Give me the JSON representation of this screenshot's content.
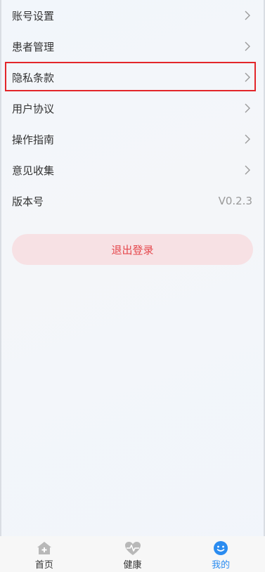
{
  "menu": {
    "items": [
      {
        "label": "账号设置"
      },
      {
        "label": "患者管理"
      },
      {
        "label": "隐私条款"
      },
      {
        "label": "用户协议"
      },
      {
        "label": "操作指南"
      },
      {
        "label": "意见收集"
      }
    ],
    "version_label": "版本号",
    "version_value": "V0.2.3",
    "highlighted_item": "隐私条款"
  },
  "logout": {
    "label": "退出登录"
  },
  "tabbar": {
    "tabs": [
      {
        "label": "首页",
        "icon": "home-icon"
      },
      {
        "label": "健康",
        "icon": "heart-pulse-icon"
      },
      {
        "label": "我的",
        "icon": "smiley-icon",
        "active": true
      }
    ]
  },
  "colors": {
    "highlight_border": "#e3262a",
    "logout_bg": "#f7e1e4",
    "logout_text": "#e5484d",
    "tab_active": "#2b8cf0",
    "tab_inactive_icon": "#b8b8b8"
  }
}
